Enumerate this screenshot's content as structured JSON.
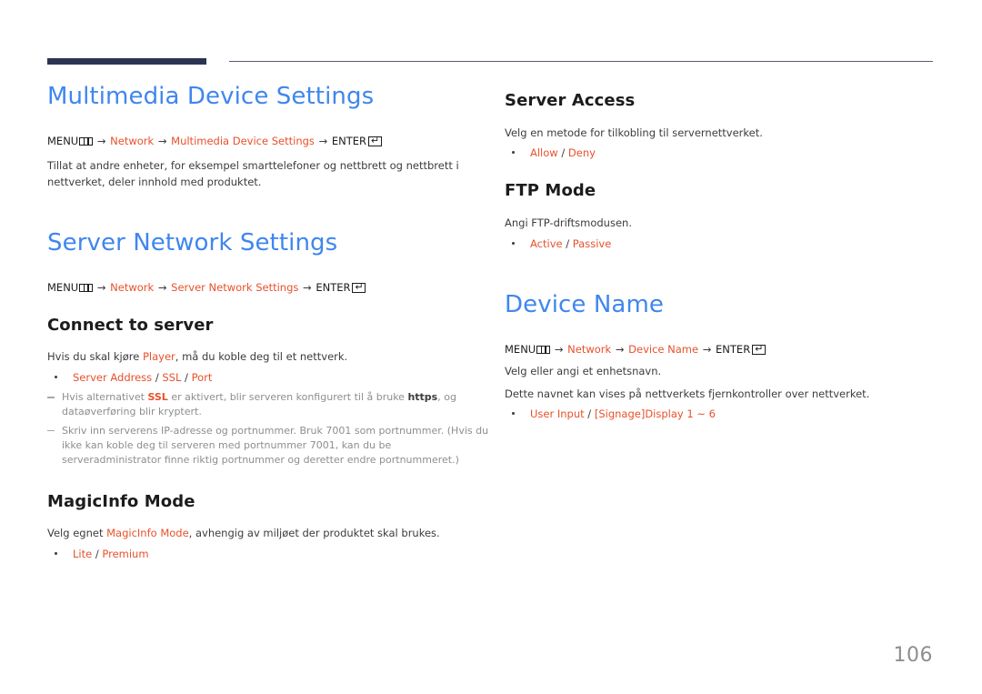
{
  "document": {
    "page_number": "106",
    "accent_orange": "#e8512a",
    "heading_blue": "#3f86ee",
    "rule_navy": "#2b3553"
  },
  "icons": {
    "menu_icon_label": "MENU",
    "enter_icon_label": "ENTER",
    "enter_glyph": "↵",
    "arrow": "→"
  },
  "left_column": {
    "sections": [
      {
        "title": "Multimedia Device Settings",
        "menu_path": {
          "menu": "MENU",
          "parts": [
            "Network",
            "Multimedia Device Settings"
          ],
          "enter": "ENTER"
        },
        "body": "Tillat at andre enheter, for eksempel smarttelefoner og nettbrett og nettbrett i nettverket, deler innhold med produktet."
      },
      {
        "title": "Server Network Settings",
        "menu_path": {
          "menu": "MENU",
          "parts": [
            "Network",
            "Server Network Settings"
          ],
          "enter": "ENTER"
        },
        "subsections": [
          {
            "title": "Connect to server",
            "body_before": "Hvis du skal kjøre ",
            "body_accent": "Player",
            "body_after": ", må du koble deg til et nettverk.",
            "options": "Server Address / SSL / Port",
            "option_items": [
              "Server Address",
              "SSL",
              "Port"
            ],
            "notes": [
              {
                "a": "Hvis alternativet ",
                "accent": "SSL",
                "b": " er aktivert, blir serveren konfigurert til å bruke ",
                "bold": "https",
                "c": ", og dataøverføring blir kryptert."
              },
              {
                "text": "Skriv inn serverens IP-adresse og portnummer. Bruk 7001 som portnummer. (Hvis du ikke kan koble deg til serveren med portnummer 7001, kan du be serveradministrator finne riktig portnummer og deretter endre portnummeret.)"
              }
            ]
          },
          {
            "title": "MagicInfo Mode",
            "body_before": "Velg egnet ",
            "body_accent": "MagicInfo Mode",
            "body_after": ", avhengig av miljøet der produktet skal brukes.",
            "option_items": [
              "Lite",
              "Premium"
            ]
          }
        ]
      }
    ]
  },
  "right_column": {
    "sections": [
      {
        "type": "sub",
        "title": "Server Access",
        "body": "Velg en metode for tilkobling til servernettverket.",
        "option_items": [
          "Allow",
          "Deny"
        ]
      },
      {
        "type": "sub",
        "title": "FTP Mode",
        "body": "Angi FTP-driftsmodusen.",
        "option_items": [
          "Active",
          "Passive"
        ]
      },
      {
        "type": "main",
        "title": "Device Name",
        "menu_path": {
          "menu": "MENU",
          "parts": [
            "Network",
            "Device Name"
          ],
          "enter": "ENTER"
        },
        "body1": "Velg eller angi et enhetsnavn.",
        "body2": "Dette navnet kan vises på nettverkets fjernkontroller over nettverket.",
        "option_items": [
          "User Input",
          "[Signage]Display  1 ~ 6"
        ]
      }
    ]
  }
}
